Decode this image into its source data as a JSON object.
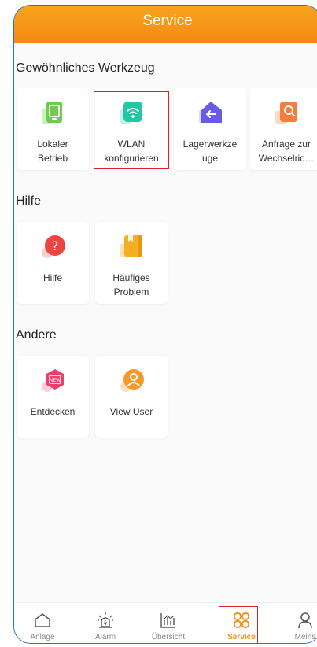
{
  "header": {
    "title": "Service"
  },
  "sections": [
    {
      "title": "Gewöhnliches Werkzeug",
      "items": [
        {
          "label": "Lokaler\nBetrieb",
          "icon": "local-operation-icon"
        },
        {
          "label": "WLAN\nkonfigurieren",
          "icon": "wifi-icon"
        },
        {
          "label": "Lagerwerkze\nuge",
          "icon": "warehouse-tools-icon"
        },
        {
          "label": "Anfrage zur\nWechselric…",
          "icon": "inverter-query-icon"
        }
      ]
    },
    {
      "title": "Hilfe",
      "items": [
        {
          "label": "Hilfe",
          "icon": "help-icon"
        },
        {
          "label": "Häufiges\nProblem",
          "icon": "faq-book-icon"
        }
      ]
    },
    {
      "title": "Andere",
      "items": [
        {
          "label": "Entdecken",
          "icon": "discover-icon"
        },
        {
          "label": "View User",
          "icon": "user-icon"
        }
      ]
    }
  ],
  "tabbar": {
    "items": [
      {
        "label": "Anlage",
        "icon": "home-icon"
      },
      {
        "label": "Alarm",
        "icon": "alarm-icon"
      },
      {
        "label": "Übersicht",
        "icon": "chart-icon"
      },
      {
        "label": "Service",
        "icon": "service-grid-icon"
      },
      {
        "label": "Meins",
        "icon": "person-icon"
      }
    ],
    "active": "Service"
  },
  "colors": {
    "accent": "#f58a12",
    "highlight": "#d92026",
    "frame": "#2a6fd1"
  }
}
